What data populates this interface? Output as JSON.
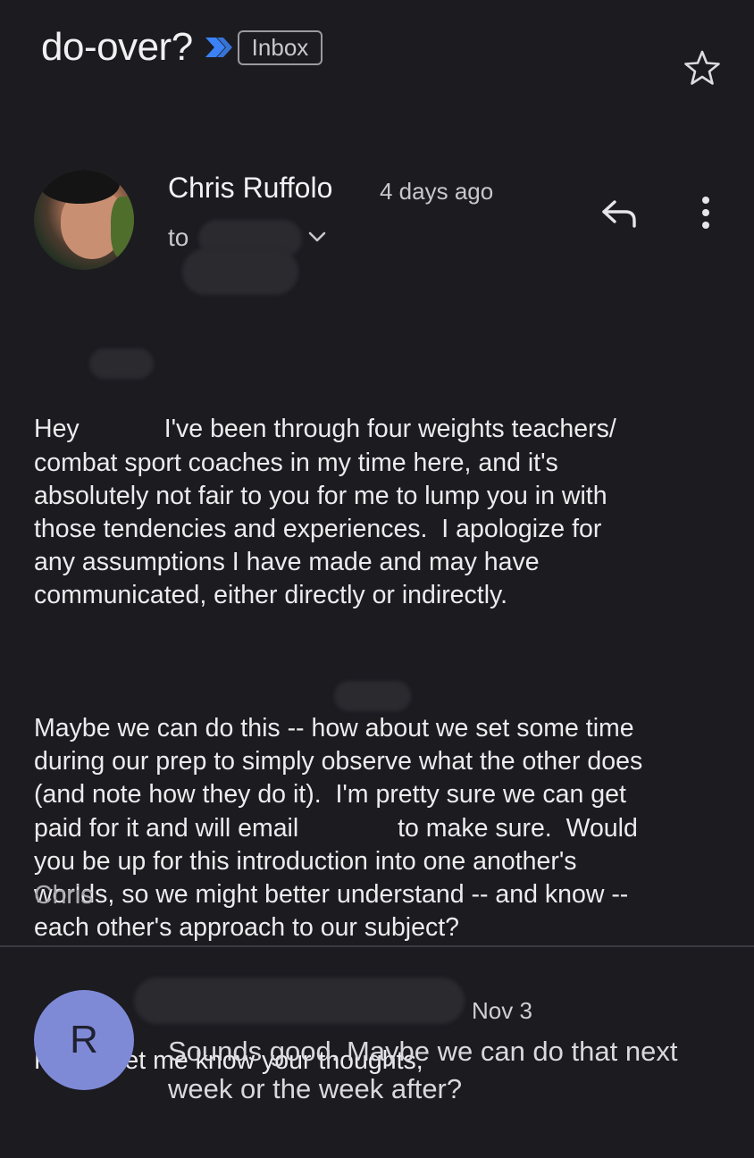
{
  "thread": {
    "subject": "do-over?",
    "label": "Inbox"
  },
  "message": {
    "sender": "Chris Ruffolo",
    "time": "4 days ago",
    "to_label": "to",
    "body": [
      "Hey            I've been through four weights teachers/\ncombat sport coaches in my time here, and it's\nabsolutely not fair to you for me to lump you in with\nthose tendencies and experiences.  I apologize for\nany assumptions I have made and may have\ncommunicated, either directly or indirectly.",
      "Maybe we can do this -- how about we set some time\nduring our prep to simply observe what the other does\n(and note how they do it).  I'm pretty sure we can get\npaid for it and will email              to make sure.  Would\nyou be up for this introduction into one another's\nworlds, so we might better understand -- and know --\neach other's approach to our subject?",
      "Please let me know your thoughts,"
    ],
    "signature": "Chris"
  },
  "reply": {
    "avatar_letter": "R",
    "date": "Nov 3",
    "snippet": "Sounds good. Maybe we can do that next week or the week after?"
  },
  "icons": {
    "importance": "importance-marker-icon",
    "star": "star-icon",
    "reply": "reply-icon",
    "more": "more-vert-icon",
    "chevron": "chevron-down-icon"
  },
  "colors": {
    "background": "#1b1b20",
    "importance": "#3b82f6",
    "avatar_r": "#7f8ad7"
  }
}
